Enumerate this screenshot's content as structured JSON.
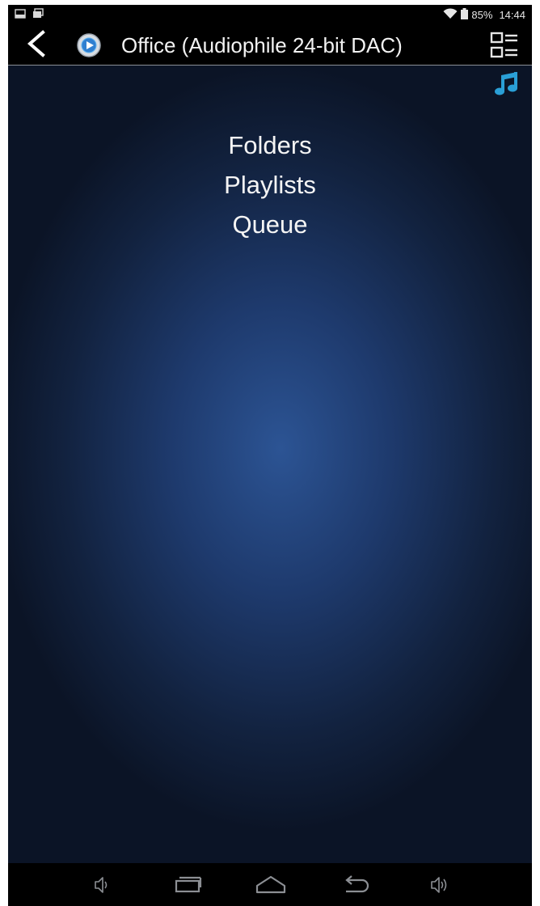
{
  "status_bar": {
    "battery_percent": "85%",
    "time": "14:44",
    "icons": [
      "screenshot-icon",
      "gallery-icon",
      "wifi-icon",
      "battery-icon"
    ]
  },
  "action_bar": {
    "title": "Office (Audiophile 24-bit DAC)",
    "icons": [
      "back-icon",
      "app-play-icon",
      "list-view-icon"
    ]
  },
  "content": {
    "corner_icon": "music-note-icon",
    "accent_color": "#2a9fd6",
    "menu": [
      {
        "label": "Folders"
      },
      {
        "label": "Playlists"
      },
      {
        "label": "Queue"
      }
    ]
  },
  "nav_bar": {
    "icons": [
      "volume-down-icon",
      "recent-apps-icon",
      "home-icon",
      "back-nav-icon",
      "volume-up-icon"
    ]
  }
}
